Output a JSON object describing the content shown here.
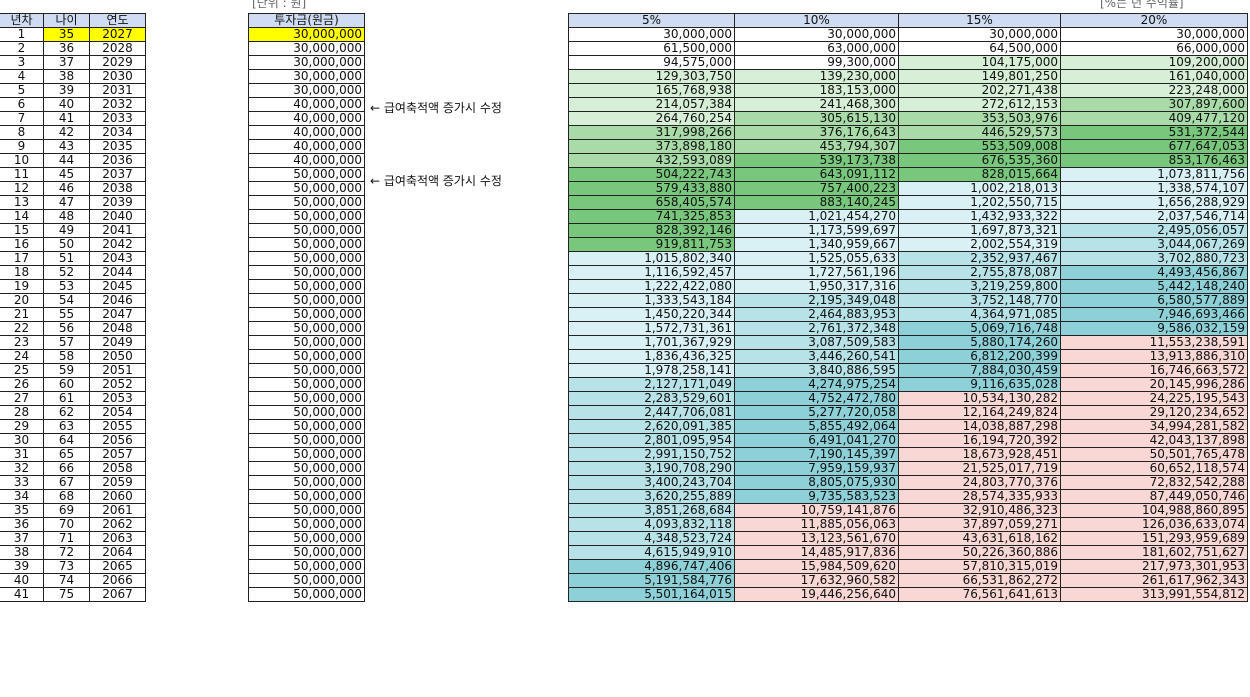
{
  "notes": {
    "unit": "[단위 : 원]",
    "rate_note": "[%는 년 수익률]"
  },
  "left_headers": [
    "년차",
    "나이",
    "연도"
  ],
  "invest_header": "투자금(원금)",
  "rate_headers": [
    "5%",
    "10%",
    "15%",
    "20%"
  ],
  "memo_text": "← 급여축적액 증가시 수정",
  "memo_rows": [
    6,
    11
  ],
  "highlight": {
    "yellow": "#ffff00",
    "light_green": "#d6efd6",
    "mid_green": "#a8dba8",
    "green": "#78c77d",
    "light_cyan": "#d9f1f4",
    "cyan": "#b7e3e8",
    "teal": "#8dd0d8",
    "pink": "#f8d7d5"
  },
  "rows": [
    {
      "n": "1",
      "age": "35",
      "year": "2027",
      "inv": "30,000,000",
      "r": [
        "30,000,000",
        "30,000,000",
        "30,000,000",
        "30,000,000"
      ],
      "c": [
        "",
        "",
        "",
        ""
      ]
    },
    {
      "n": "2",
      "age": "36",
      "year": "2028",
      "inv": "30,000,000",
      "r": [
        "61,500,000",
        "63,000,000",
        "64,500,000",
        "66,000,000"
      ],
      "c": [
        "",
        "",
        "",
        ""
      ]
    },
    {
      "n": "3",
      "age": "37",
      "year": "2029",
      "inv": "30,000,000",
      "r": [
        "94,575,000",
        "99,300,000",
        "104,175,000",
        "109,200,000"
      ],
      "c": [
        "",
        "",
        "lg",
        "lg"
      ]
    },
    {
      "n": "4",
      "age": "38",
      "year": "2030",
      "inv": "30,000,000",
      "r": [
        "129,303,750",
        "139,230,000",
        "149,801,250",
        "161,040,000"
      ],
      "c": [
        "lg",
        "lg",
        "lg",
        "lg"
      ]
    },
    {
      "n": "5",
      "age": "39",
      "year": "2031",
      "inv": "30,000,000",
      "r": [
        "165,768,938",
        "183,153,000",
        "202,271,438",
        "223,248,000"
      ],
      "c": [
        "lg",
        "lg",
        "lg",
        "lg"
      ]
    },
    {
      "n": "6",
      "age": "40",
      "year": "2032",
      "inv": "40,000,000",
      "r": [
        "214,057,384",
        "241,468,300",
        "272,612,153",
        "307,897,600"
      ],
      "c": [
        "lg",
        "lg",
        "lg",
        "mg"
      ]
    },
    {
      "n": "7",
      "age": "41",
      "year": "2033",
      "inv": "40,000,000",
      "r": [
        "264,760,254",
        "305,615,130",
        "353,503,976",
        "409,477,120"
      ],
      "c": [
        "lg",
        "mg",
        "mg",
        "mg"
      ]
    },
    {
      "n": "8",
      "age": "42",
      "year": "2034",
      "inv": "40,000,000",
      "r": [
        "317,998,266",
        "376,176,643",
        "446,529,573",
        "531,372,544"
      ],
      "c": [
        "mg",
        "mg",
        "mg",
        "g"
      ]
    },
    {
      "n": "9",
      "age": "43",
      "year": "2035",
      "inv": "40,000,000",
      "r": [
        "373,898,180",
        "453,794,307",
        "553,509,008",
        "677,647,053"
      ],
      "c": [
        "mg",
        "mg",
        "g",
        "g"
      ]
    },
    {
      "n": "10",
      "age": "44",
      "year": "2036",
      "inv": "40,000,000",
      "r": [
        "432,593,089",
        "539,173,738",
        "676,535,360",
        "853,176,463"
      ],
      "c": [
        "mg",
        "g",
        "g",
        "g"
      ]
    },
    {
      "n": "11",
      "age": "45",
      "year": "2037",
      "inv": "50,000,000",
      "r": [
        "504,222,743",
        "643,091,112",
        "828,015,664",
        "1,073,811,756"
      ],
      "c": [
        "g",
        "g",
        "g",
        "lc"
      ]
    },
    {
      "n": "12",
      "age": "46",
      "year": "2038",
      "inv": "50,000,000",
      "r": [
        "579,433,880",
        "757,400,223",
        "1,002,218,013",
        "1,338,574,107"
      ],
      "c": [
        "g",
        "g",
        "lc",
        "lc"
      ]
    },
    {
      "n": "13",
      "age": "47",
      "year": "2039",
      "inv": "50,000,000",
      "r": [
        "658,405,574",
        "883,140,245",
        "1,202,550,715",
        "1,656,288,929"
      ],
      "c": [
        "g",
        "g",
        "lc",
        "lc"
      ]
    },
    {
      "n": "14",
      "age": "48",
      "year": "2040",
      "inv": "50,000,000",
      "r": [
        "741,325,853",
        "1,021,454,270",
        "1,432,933,322",
        "2,037,546,714"
      ],
      "c": [
        "g",
        "lc",
        "lc",
        "lc"
      ]
    },
    {
      "n": "15",
      "age": "49",
      "year": "2041",
      "inv": "50,000,000",
      "r": [
        "828,392,146",
        "1,173,599,697",
        "1,697,873,321",
        "2,495,056,057"
      ],
      "c": [
        "g",
        "lc",
        "lc",
        "c"
      ]
    },
    {
      "n": "16",
      "age": "50",
      "year": "2042",
      "inv": "50,000,000",
      "r": [
        "919,811,753",
        "1,340,959,667",
        "2,002,554,319",
        "3,044,067,269"
      ],
      "c": [
        "g",
        "lc",
        "lc",
        "c"
      ]
    },
    {
      "n": "17",
      "age": "51",
      "year": "2043",
      "inv": "50,000,000",
      "r": [
        "1,015,802,340",
        "1,525,055,633",
        "2,352,937,467",
        "3,702,880,723"
      ],
      "c": [
        "lc",
        "lc",
        "c",
        "c"
      ]
    },
    {
      "n": "18",
      "age": "52",
      "year": "2044",
      "inv": "50,000,000",
      "r": [
        "1,116,592,457",
        "1,727,561,196",
        "2,755,878,087",
        "4,493,456,867"
      ],
      "c": [
        "lc",
        "lc",
        "c",
        "t"
      ]
    },
    {
      "n": "19",
      "age": "53",
      "year": "2045",
      "inv": "50,000,000",
      "r": [
        "1,222,422,080",
        "1,950,317,316",
        "3,219,259,800",
        "5,442,148,240"
      ],
      "c": [
        "lc",
        "lc",
        "c",
        "t"
      ]
    },
    {
      "n": "20",
      "age": "54",
      "year": "2046",
      "inv": "50,000,000",
      "r": [
        "1,333,543,184",
        "2,195,349,048",
        "3,752,148,770",
        "6,580,577,889"
      ],
      "c": [
        "lc",
        "c",
        "c",
        "t"
      ]
    },
    {
      "n": "21",
      "age": "55",
      "year": "2047",
      "inv": "50,000,000",
      "r": [
        "1,450,220,344",
        "2,464,883,953",
        "4,364,971,085",
        "7,946,693,466"
      ],
      "c": [
        "lc",
        "c",
        "c",
        "t"
      ]
    },
    {
      "n": "22",
      "age": "56",
      "year": "2048",
      "inv": "50,000,000",
      "r": [
        "1,572,731,361",
        "2,761,372,348",
        "5,069,716,748",
        "9,586,032,159"
      ],
      "c": [
        "lc",
        "c",
        "t",
        "t"
      ]
    },
    {
      "n": "23",
      "age": "57",
      "year": "2049",
      "inv": "50,000,000",
      "r": [
        "1,701,367,929",
        "3,087,509,583",
        "5,880,174,260",
        "11,553,238,591"
      ],
      "c": [
        "lc",
        "c",
        "t",
        "p"
      ]
    },
    {
      "n": "24",
      "age": "58",
      "year": "2050",
      "inv": "50,000,000",
      "r": [
        "1,836,436,325",
        "3,446,260,541",
        "6,812,200,399",
        "13,913,886,310"
      ],
      "c": [
        "lc",
        "c",
        "t",
        "p"
      ]
    },
    {
      "n": "25",
      "age": "59",
      "year": "2051",
      "inv": "50,000,000",
      "r": [
        "1,978,258,141",
        "3,840,886,595",
        "7,884,030,459",
        "16,746,663,572"
      ],
      "c": [
        "lc",
        "c",
        "t",
        "p"
      ]
    },
    {
      "n": "26",
      "age": "60",
      "year": "2052",
      "inv": "50,000,000",
      "r": [
        "2,127,171,049",
        "4,274,975,254",
        "9,116,635,028",
        "20,145,996,286"
      ],
      "c": [
        "c",
        "t",
        "t",
        "p"
      ]
    },
    {
      "n": "27",
      "age": "61",
      "year": "2053",
      "inv": "50,000,000",
      "r": [
        "2,283,529,601",
        "4,752,472,780",
        "10,534,130,282",
        "24,225,195,543"
      ],
      "c": [
        "c",
        "t",
        "p",
        "p"
      ]
    },
    {
      "n": "28",
      "age": "62",
      "year": "2054",
      "inv": "50,000,000",
      "r": [
        "2,447,706,081",
        "5,277,720,058",
        "12,164,249,824",
        "29,120,234,652"
      ],
      "c": [
        "c",
        "t",
        "p",
        "p"
      ]
    },
    {
      "n": "29",
      "age": "63",
      "year": "2055",
      "inv": "50,000,000",
      "r": [
        "2,620,091,385",
        "5,855,492,064",
        "14,038,887,298",
        "34,994,281,582"
      ],
      "c": [
        "c",
        "t",
        "p",
        "p"
      ]
    },
    {
      "n": "30",
      "age": "64",
      "year": "2056",
      "inv": "50,000,000",
      "r": [
        "2,801,095,954",
        "6,491,041,270",
        "16,194,720,392",
        "42,043,137,898"
      ],
      "c": [
        "c",
        "t",
        "p",
        "p"
      ]
    },
    {
      "n": "31",
      "age": "65",
      "year": "2057",
      "inv": "50,000,000",
      "r": [
        "2,991,150,752",
        "7,190,145,397",
        "18,673,928,451",
        "50,501,765,478"
      ],
      "c": [
        "c",
        "t",
        "p",
        "p"
      ]
    },
    {
      "n": "32",
      "age": "66",
      "year": "2058",
      "inv": "50,000,000",
      "r": [
        "3,190,708,290",
        "7,959,159,937",
        "21,525,017,719",
        "60,652,118,574"
      ],
      "c": [
        "c",
        "t",
        "p",
        "p"
      ]
    },
    {
      "n": "33",
      "age": "67",
      "year": "2059",
      "inv": "50,000,000",
      "r": [
        "3,400,243,704",
        "8,805,075,930",
        "24,803,770,376",
        "72,832,542,288"
      ],
      "c": [
        "c",
        "t",
        "p",
        "p"
      ]
    },
    {
      "n": "34",
      "age": "68",
      "year": "2060",
      "inv": "50,000,000",
      "r": [
        "3,620,255,889",
        "9,735,583,523",
        "28,574,335,933",
        "87,449,050,746"
      ],
      "c": [
        "c",
        "t",
        "p",
        "p"
      ]
    },
    {
      "n": "35",
      "age": "69",
      "year": "2061",
      "inv": "50,000,000",
      "r": [
        "3,851,268,684",
        "10,759,141,876",
        "32,910,486,323",
        "104,988,860,895"
      ],
      "c": [
        "c",
        "p",
        "p",
        "p"
      ]
    },
    {
      "n": "36",
      "age": "70",
      "year": "2062",
      "inv": "50,000,000",
      "r": [
        "4,093,832,118",
        "11,885,056,063",
        "37,897,059,271",
        "126,036,633,074"
      ],
      "c": [
        "c",
        "p",
        "p",
        "p"
      ]
    },
    {
      "n": "37",
      "age": "71",
      "year": "2063",
      "inv": "50,000,000",
      "r": [
        "4,348,523,724",
        "13,123,561,670",
        "43,631,618,162",
        "151,293,959,689"
      ],
      "c": [
        "c",
        "p",
        "p",
        "p"
      ]
    },
    {
      "n": "38",
      "age": "72",
      "year": "2064",
      "inv": "50,000,000",
      "r": [
        "4,615,949,910",
        "14,485,917,836",
        "50,226,360,886",
        "181,602,751,627"
      ],
      "c": [
        "c",
        "p",
        "p",
        "p"
      ]
    },
    {
      "n": "39",
      "age": "73",
      "year": "2065",
      "inv": "50,000,000",
      "r": [
        "4,896,747,406",
        "15,984,509,620",
        "57,810,315,019",
        "217,973,301,953"
      ],
      "c": [
        "t",
        "p",
        "p",
        "p"
      ]
    },
    {
      "n": "40",
      "age": "74",
      "year": "2066",
      "inv": "50,000,000",
      "r": [
        "5,191,584,776",
        "17,632,960,582",
        "66,531,862,272",
        "261,617,962,343"
      ],
      "c": [
        "t",
        "p",
        "p",
        "p"
      ]
    },
    {
      "n": "41",
      "age": "75",
      "year": "2067",
      "inv": "50,000,000",
      "r": [
        "5,501,164,015",
        "19,446,256,640",
        "76,561,641,613",
        "313,991,554,812"
      ],
      "c": [
        "t",
        "p",
        "p",
        "p"
      ]
    }
  ]
}
